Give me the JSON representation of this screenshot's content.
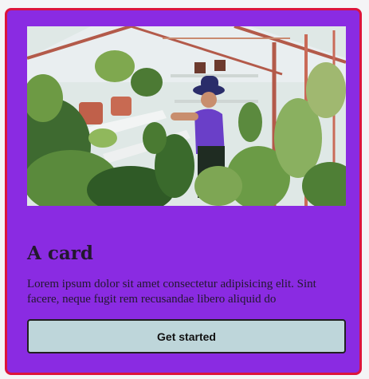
{
  "card": {
    "image_subject": "woman-tending-plants-in-greenhouse",
    "title": "A card",
    "body": "Lorem ipsum dolor sit amet consectetur adipisicing elit. Sint facere, neque fugit rem recusandae libero aliquid do",
    "button_label": "Get started",
    "colors": {
      "background": "#8a2be2",
      "border": "#dc143c",
      "button_background": "#bed6da",
      "text": "#22182e"
    }
  }
}
